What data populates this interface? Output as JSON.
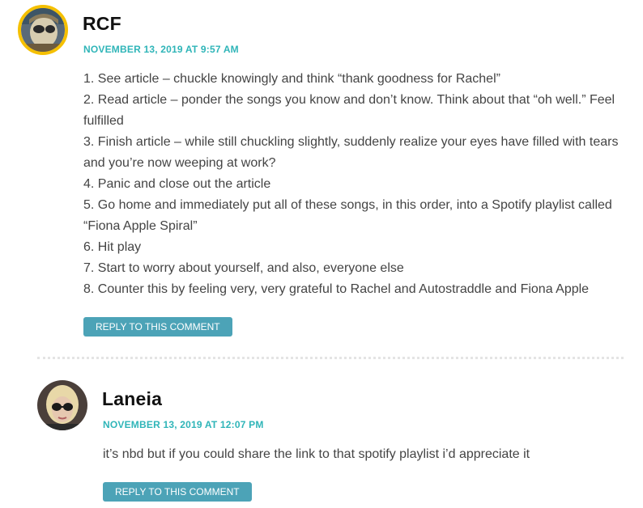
{
  "comments": [
    {
      "author": "RCF",
      "date": "NOVEMBER 13, 2019 AT 9:57 AM",
      "lines": [
        "1. See article – chuckle knowingly and think “thank goodness for Rachel”",
        "2. Read article – ponder the songs you know and don’t know. Think about that “oh well.” Feel fulfilled",
        "3. Finish article – while still chuckling slightly, suddenly realize your eyes have filled with tears and you’re now weeping at work?",
        "4. Panic and close out the article",
        "5. Go home and immediately put all of these songs, in this order, into a Spotify playlist called “Fiona Apple Spiral”",
        "6. Hit play",
        "7. Start to worry about yourself, and also, everyone else",
        "8. Counter this by feeling very, very grateful to Rachel and Autostraddle and Fiona Apple"
      ],
      "reply_label": "REPLY TO THIS COMMENT"
    },
    {
      "author": "Laneia",
      "date": "NOVEMBER 13, 2019 AT 12:07 PM",
      "lines": [
        "it’s nbd but if you could share the link to that spotify playlist i’d appreciate it"
      ],
      "reply_label": "REPLY TO THIS COMMENT"
    }
  ],
  "colors": {
    "date": "#2fb5b8",
    "reply_button": "#4ca3b7",
    "avatar_ring": "#f5c000"
  }
}
